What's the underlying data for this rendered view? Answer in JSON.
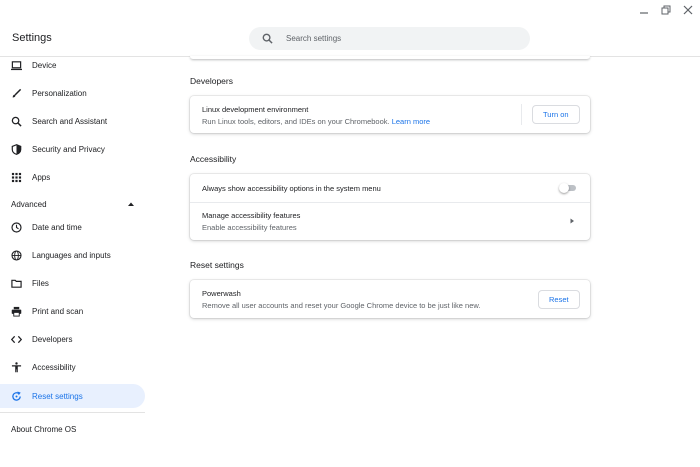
{
  "window": {
    "controls": [
      "minimize-icon",
      "restore-icon",
      "close-icon"
    ]
  },
  "header": {
    "title": "Settings",
    "search_placeholder": "Search settings",
    "search_value": ""
  },
  "sidebar": {
    "items": [
      {
        "label": "Device",
        "icon": "laptop-icon"
      },
      {
        "label": "Personalization",
        "icon": "brush-icon"
      },
      {
        "label": "Search and Assistant",
        "icon": "search-icon"
      },
      {
        "label": "Security and Privacy",
        "icon": "shield-icon"
      },
      {
        "label": "Apps",
        "icon": "apps-grid-icon"
      }
    ],
    "advanced_label": "Advanced",
    "advanced_items": [
      {
        "label": "Date and time",
        "icon": "clock-icon"
      },
      {
        "label": "Languages and inputs",
        "icon": "globe-icon"
      },
      {
        "label": "Files",
        "icon": "folder-icon"
      },
      {
        "label": "Print and scan",
        "icon": "printer-icon"
      },
      {
        "label": "Developers",
        "icon": "code-icon"
      },
      {
        "label": "Accessibility",
        "icon": "accessibility-icon"
      },
      {
        "label": "Reset settings",
        "icon": "reset-icon",
        "active": true
      }
    ],
    "about_label": "About Chrome OS"
  },
  "main": {
    "developers": {
      "title": "Developers",
      "linux": {
        "primary": "Linux development environment",
        "secondary": "Run Linux tools, editors, and IDEs on your Chromebook.",
        "link": "Learn more",
        "button": "Turn on"
      }
    },
    "accessibility": {
      "title": "Accessibility",
      "always_show": {
        "primary": "Always show accessibility options in the system menu",
        "toggle_on": false
      },
      "manage": {
        "primary": "Manage accessibility features",
        "secondary": "Enable accessibility features"
      }
    },
    "reset": {
      "title": "Reset settings",
      "powerwash": {
        "primary": "Powerwash",
        "secondary": "Remove all user accounts and reset your Google Chrome device to be just like new.",
        "button": "Reset"
      }
    }
  },
  "colors": {
    "accent": "#1a73e8",
    "active_bg": "#e8f0fe",
    "text_primary": "#202124",
    "text_secondary": "#5f6368"
  }
}
